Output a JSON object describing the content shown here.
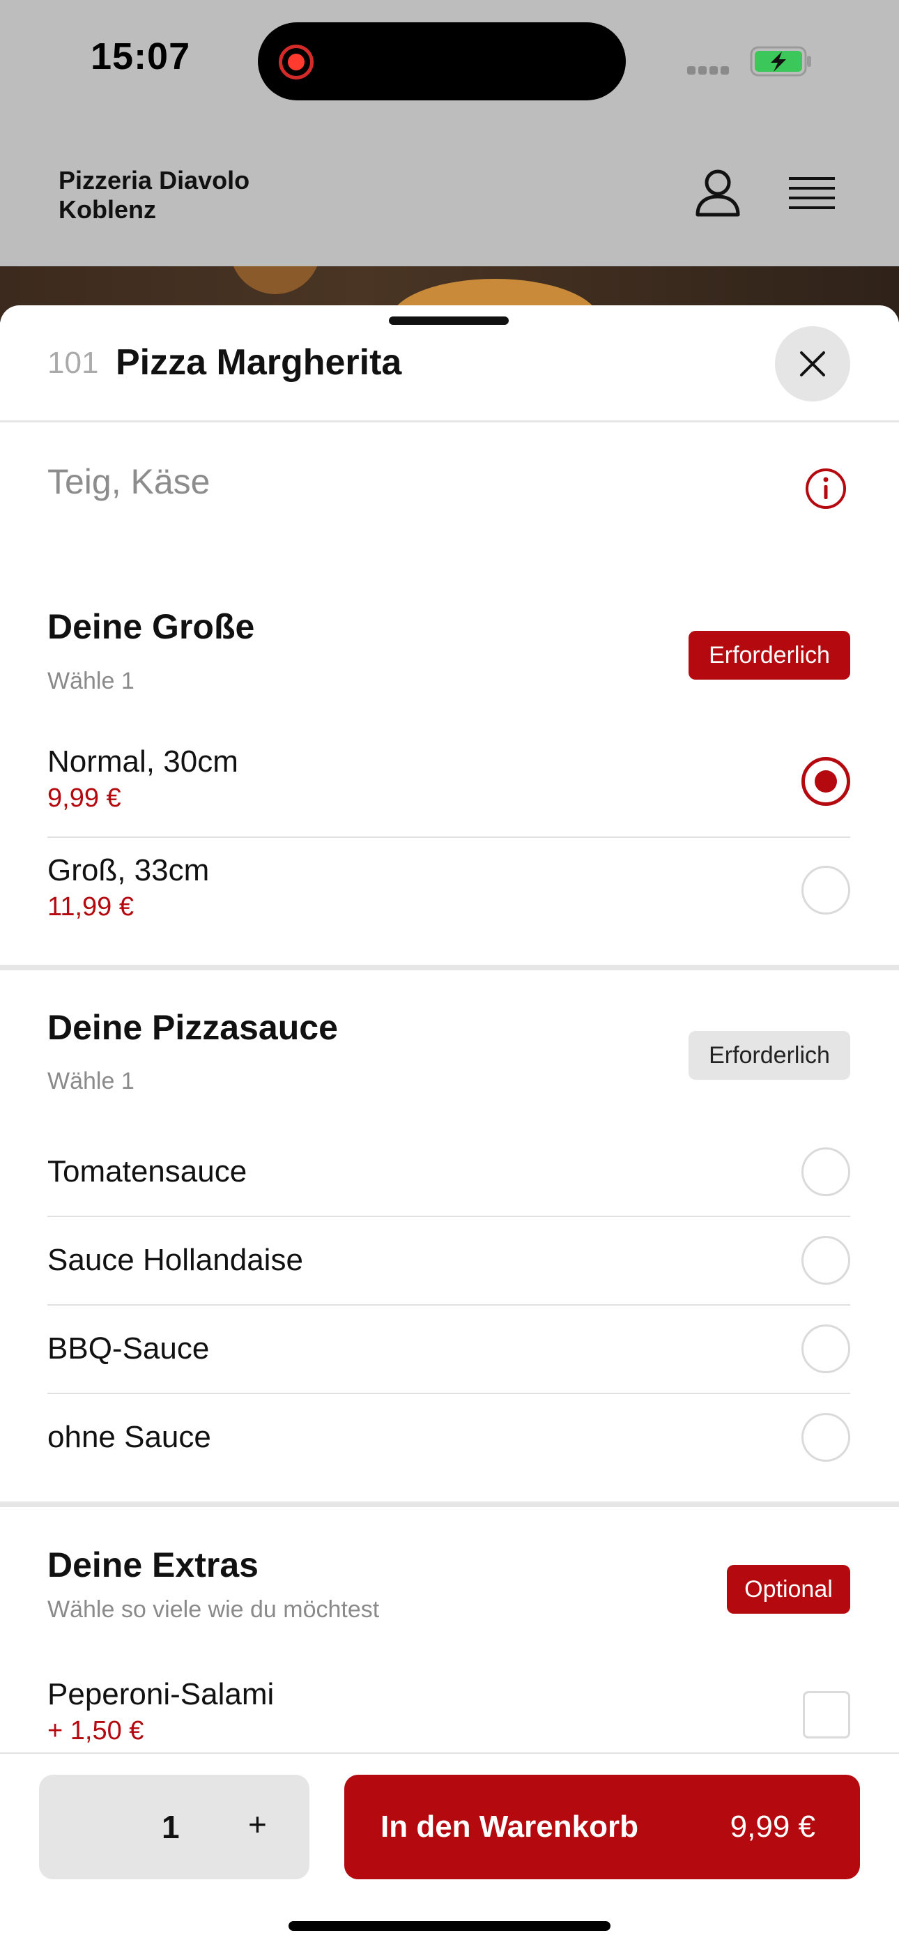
{
  "status_bar": {
    "time": "15:07"
  },
  "header": {
    "brand_line1": "Pizzeria Diavolo",
    "brand_line2": "Koblenz"
  },
  "item": {
    "number": "101",
    "name": "Pizza Margherita",
    "ingredients": "Teig, Käse"
  },
  "sections": [
    {
      "title": "Deine Große",
      "subtitle": "Wähle 1",
      "badge": "Erforderlich",
      "options": [
        {
          "label": "Normal, 30cm",
          "price": "9,99 €",
          "selected": true
        },
        {
          "label": "Groß, 33cm",
          "price": "11,99 €",
          "selected": false
        }
      ]
    },
    {
      "title": "Deine Pizzasauce",
      "subtitle": "Wähle 1",
      "badge": "Erforderlich",
      "options": [
        {
          "label": "Tomatensauce"
        },
        {
          "label": "Sauce Hollandaise"
        },
        {
          "label": "BBQ-Sauce"
        },
        {
          "label": "ohne Sauce"
        }
      ]
    },
    {
      "title": "Deine Extras",
      "subtitle": "Wähle so viele wie du möchtest",
      "badge": "Optional",
      "options": [
        {
          "label": "Peperoni-Salami",
          "price": "+ 1,50 €"
        }
      ]
    }
  ],
  "bottom_bar": {
    "quantity": "1",
    "plus": "+",
    "cart_label": "In den Warenkorb",
    "cart_price": "9,99 €"
  },
  "colors": {
    "accent": "#b4090f",
    "badge_grey": "#e5e5e5"
  }
}
